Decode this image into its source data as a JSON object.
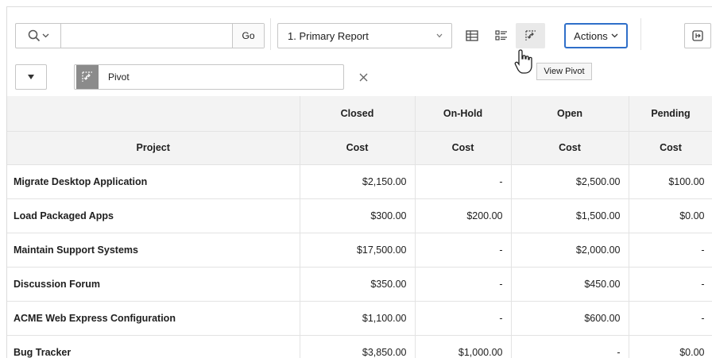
{
  "toolbar": {
    "search_placeholder": "",
    "go_label": "Go",
    "report_select": "1. Primary Report",
    "actions_label": "Actions",
    "tooltip": "View Pivot"
  },
  "filter": {
    "chip_label": "Pivot"
  },
  "icons": {
    "search": "search-icon",
    "grid": "grid-view-icon",
    "detail": "detail-view-icon",
    "pivot": "pivot-view-icon",
    "collapse": "caret-down-icon",
    "close": "close-icon",
    "export": "export-icon"
  },
  "colors": {
    "accent": "#2f6fc9",
    "header_link": "#2a64b4",
    "header_bg": "#f3f3f3"
  },
  "table": {
    "pivot_headers": [
      "",
      "Closed",
      "On-Hold",
      "Open",
      "Pending"
    ],
    "sub_headers": [
      "Project",
      "Cost",
      "Cost",
      "Cost",
      "Cost"
    ],
    "rows": [
      [
        "Migrate Desktop Application",
        "$2,150.00",
        "-",
        "$2,500.00",
        "$100.00"
      ],
      [
        "Load Packaged Apps",
        "$300.00",
        "$200.00",
        "$1,500.00",
        "$0.00"
      ],
      [
        "Maintain Support Systems",
        "$17,500.00",
        "-",
        "$2,000.00",
        "-"
      ],
      [
        "Discussion Forum",
        "$350.00",
        "-",
        "$450.00",
        "-"
      ],
      [
        "ACME Web Express Configuration",
        "$1,100.00",
        "-",
        "$600.00",
        "-"
      ],
      [
        "Bug Tracker",
        "$3,850.00",
        "$1,000.00",
        "-",
        "$0.00"
      ]
    ]
  }
}
